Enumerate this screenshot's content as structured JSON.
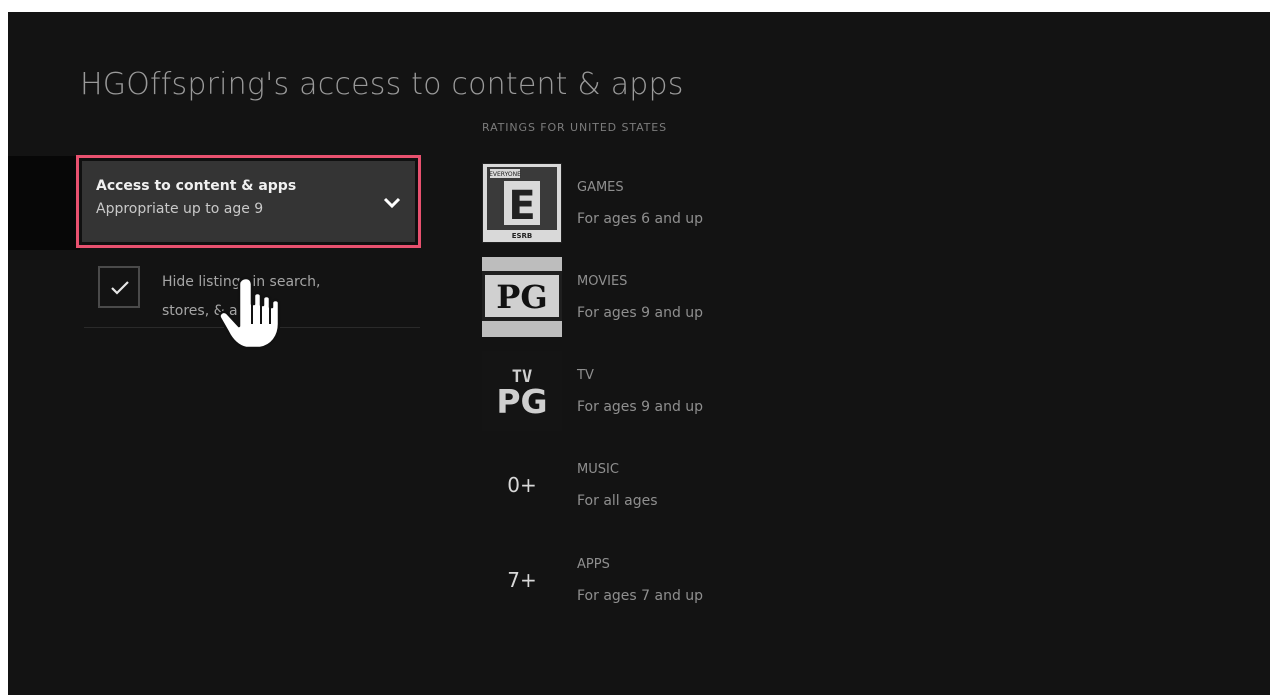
{
  "page": {
    "title": "HGOffspring's access to content & apps"
  },
  "dropdown": {
    "label": "Access to content & apps",
    "value": "Appropriate up to age 9",
    "icon": "chevron-down-icon"
  },
  "checkbox": {
    "label": "Hide listings in search, stores, & apps",
    "checked": true
  },
  "ratings": {
    "header": "RATINGS FOR UNITED STATES",
    "items": [
      {
        "name": "GAMES",
        "desc": "For ages 6 and up",
        "badge": "ESRB E",
        "badge_top": "EVERYONE",
        "badge_letter": "E",
        "badge_bottom": "ESRB"
      },
      {
        "name": "MOVIES",
        "desc": "For ages 9 and up",
        "badge": "PG"
      },
      {
        "name": "TV",
        "desc": "For ages 9 and up",
        "badge_top": "TV",
        "badge_bottom": "PG"
      },
      {
        "name": "MUSIC",
        "desc": "For all ages",
        "badge": "0+"
      },
      {
        "name": "APPS",
        "desc": "For ages 7 and up",
        "badge": "7+"
      }
    ]
  },
  "colors": {
    "background": "#131313",
    "focus_border": "#e8516f",
    "dropdown_bg": "#343434"
  }
}
